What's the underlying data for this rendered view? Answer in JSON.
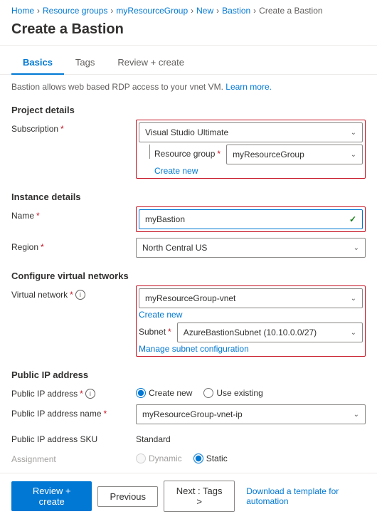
{
  "breadcrumb": {
    "items": [
      {
        "label": "Home",
        "link": true
      },
      {
        "label": "Resource groups",
        "link": true
      },
      {
        "label": "myResourceGroup",
        "link": true
      },
      {
        "label": "New",
        "link": true
      },
      {
        "label": "Bastion",
        "link": true
      },
      {
        "label": "Create a Bastion",
        "link": false
      }
    ]
  },
  "page_title": "Create a Bastion",
  "tabs": [
    {
      "label": "Basics",
      "active": true
    },
    {
      "label": "Tags",
      "active": false
    },
    {
      "label": "Review + create",
      "active": false
    }
  ],
  "description": {
    "text": "Bastion allows web based RDP access to your vnet VM.",
    "link_text": "Learn more."
  },
  "sections": {
    "project_details": {
      "title": "Project details",
      "subscription_label": "Subscription",
      "subscription_value": "Visual Studio Ultimate",
      "resource_group_label": "Resource group",
      "resource_group_value": "myResourceGroup",
      "create_new": "Create new"
    },
    "instance_details": {
      "title": "Instance details",
      "name_label": "Name",
      "name_value": "myBastion",
      "region_label": "Region",
      "region_value": "North Central US"
    },
    "virtual_networks": {
      "title": "Configure virtual networks",
      "vnet_label": "Virtual network",
      "vnet_value": "myResourceGroup-vnet",
      "create_new": "Create new",
      "subnet_label": "Subnet",
      "subnet_value": "AzureBastionSubnet (10.10.0.0/27)",
      "manage_link": "Manage subnet configuration"
    },
    "public_ip": {
      "title": "Public IP address",
      "ip_label": "Public IP address",
      "ip_options": [
        "Create new",
        "Use existing"
      ],
      "ip_selected": "Create new",
      "ip_name_label": "Public IP address name",
      "ip_name_value": "myResourceGroup-vnet-ip",
      "ip_sku_label": "Public IP address SKU",
      "ip_sku_value": "Standard",
      "assignment_label": "Assignment",
      "assignment_options": [
        "Dynamic",
        "Static"
      ],
      "assignment_selected": "Static"
    }
  },
  "footer": {
    "review_create": "Review + create",
    "previous": "Previous",
    "next": "Next : Tags >",
    "download_link": "Download a template for automation"
  }
}
